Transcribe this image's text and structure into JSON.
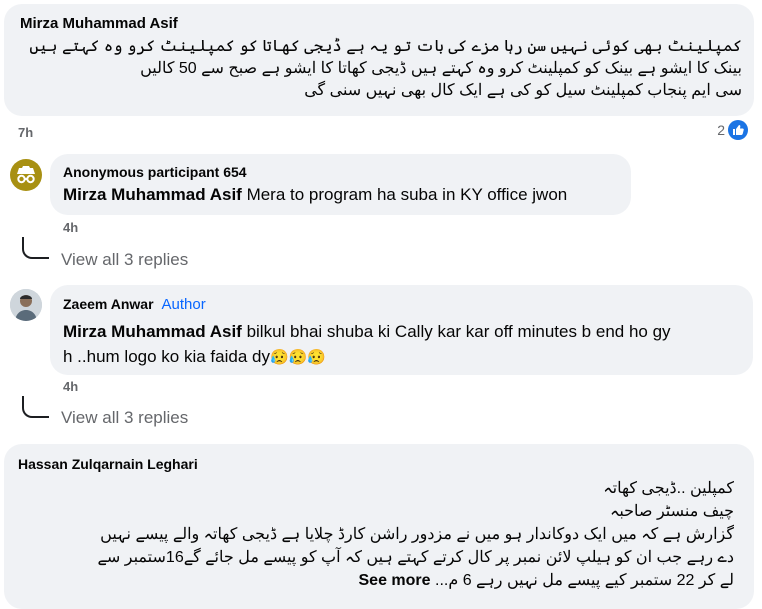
{
  "comment1": {
    "author": "Mirza Muhammad Asif",
    "lines": [
      "کمپلینٹ بھی کوئی نہیں سن رہا مزے کی بات تو یہ ہے ڈیجی کھاتا کو کمپلینٹ کرو وہ کہتے ہیں",
      "بینک کا ایشو ہے بینک کو کمپلینٹ کرو وہ کہتے ہیں ڈیجی کھاتا کا ایشو ہے صبح سے 50 کالیں",
      "سی ایم پنجاب کمپلینٹ سیل کو کی ہے ایک کال بھی نہیں سنی گی"
    ],
    "time": "7h",
    "reaction_count": "2"
  },
  "reply1": {
    "author": "Anonymous participant 654",
    "mention": "Mirza Muhammad Asif",
    "text": " Mera to program ha suba in KY office jwon",
    "time": "4h"
  },
  "view_replies_1": "View all 3 replies",
  "reply2": {
    "author": "Zaeem Anwar",
    "badge": "Author",
    "mention": "Mirza Muhammad Asif",
    "text_line1": " bilkul bhai shuba ki Cally kar kar off minutes b end ho gy",
    "text_line2": "h ..hum logo ko kia faida dy",
    "emoji": "😥😥😥",
    "time": "4h"
  },
  "view_replies_2": "View all 3 replies",
  "comment2": {
    "author": "Hassan Zulqarnain Leghari",
    "lines": [
      "کمپلین ..ڈیجی کھاتہ",
      "چیف منسٹر صاحبہ",
      "گزارش ہے کہ میں ایک دوکاندار ہو میں نے مزدور راشن کارڈ چلایا ہے ڈیجی کھاتہ والے پیسے نہیں",
      "دے رہے جب ان کو ہیلپ لائن نمبر پر کال کرتے کہتے ہیں کہ آپ کو پیسے مل جائے گے16ستمبر سے"
    ],
    "last_line": "لے کر 22 ستمبر کیے پیسے مل نہیں رہے 6 م...",
    "see_more": "See more"
  },
  "colors": {
    "bubble": "#f0f2f5",
    "meta": "#65676b",
    "accent": "#0866ff"
  }
}
